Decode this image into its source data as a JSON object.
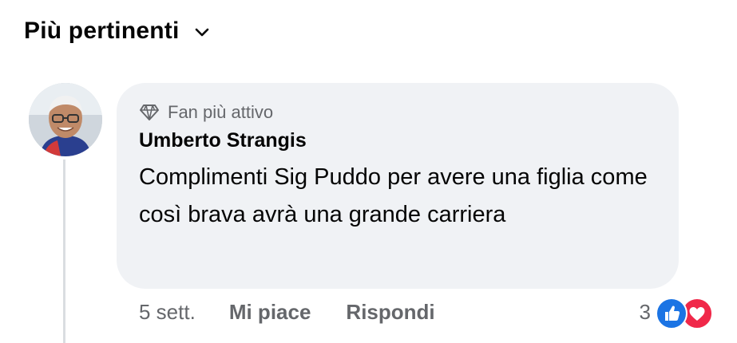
{
  "sort": {
    "label": "Più pertinenti",
    "icon": "chevron-down-icon"
  },
  "comment": {
    "avatar": "avatar",
    "badge_icon": "diamond-icon",
    "badge": "Fan più attivo",
    "author": "Umberto Strangis",
    "text": "Complimenti Sig Puddo per avere una figlia come così brava avrà una grande carriera",
    "time": "5 sett.",
    "like_label": "Mi piace",
    "reply_label": "Rispondi",
    "reaction_count": "3",
    "reaction_icons": [
      "like-reaction-icon",
      "love-reaction-icon"
    ]
  },
  "colors": {
    "bubble": "#f0f2f5",
    "secondary_text": "#65676b",
    "like_blue": "#1b74e4",
    "love_red": "#f02849"
  }
}
